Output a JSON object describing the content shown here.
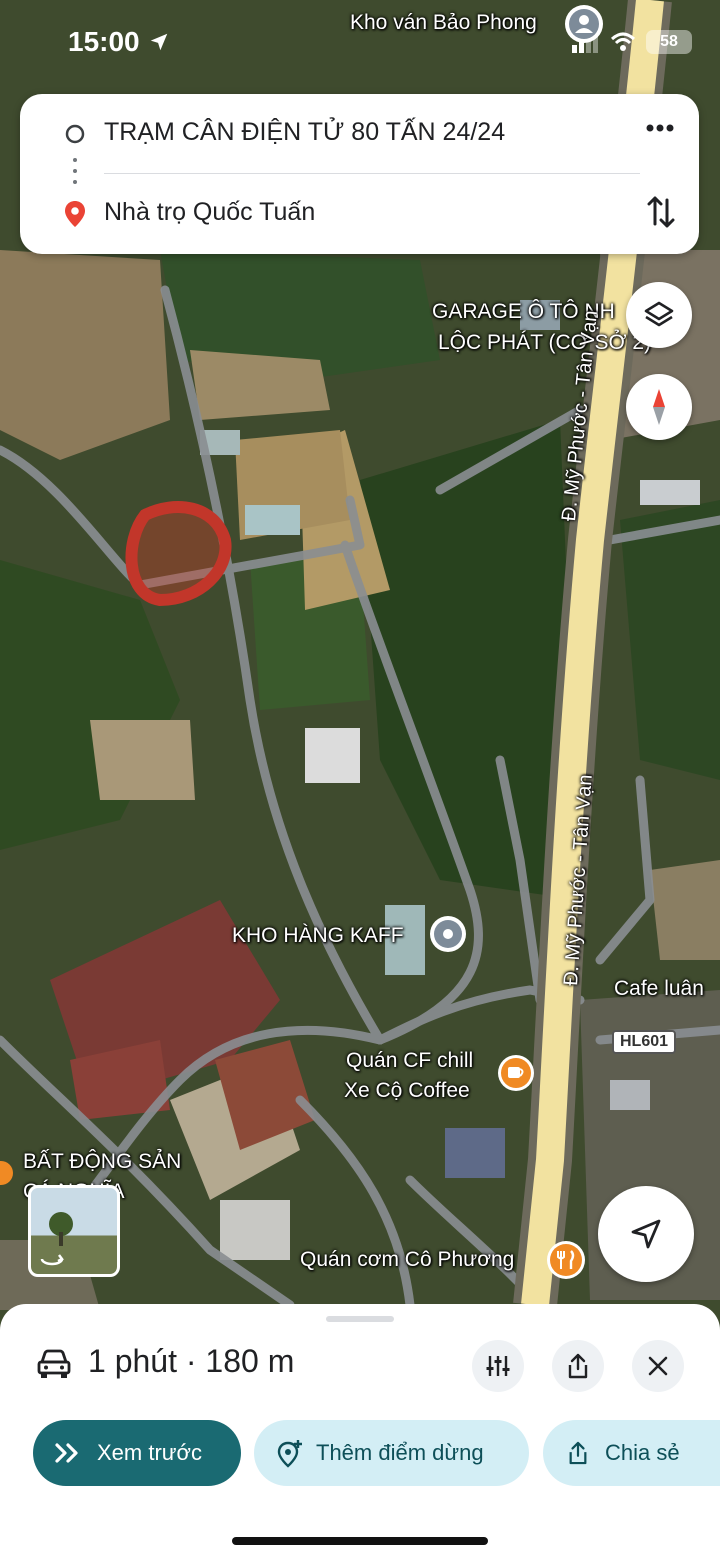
{
  "status_bar": {
    "time": "15:00",
    "battery": "58"
  },
  "route": {
    "origin": "TRẠM CÂN ĐIỆN TỬ 80 TẤN 24/24",
    "destination": "Nhà trọ Quốc Tuấn"
  },
  "map_labels": {
    "kho_van": "Kho ván Bảo Phong",
    "garage_line1": "GARAGE Ô TÔ NH",
    "garage_line2": "LỘC PHÁT (CƠ SỞ 2)",
    "road_upper": "Đ. Mỹ Phước - Tân Vạn",
    "road_lower": "Đ. Mỹ Phước - Tân Vạn",
    "kho_hang": "KHO HÀNG KAFF",
    "cafe_luan": "Cafe luân",
    "hl601": "HL601",
    "quan_cf_line1": "Quán CF chill",
    "quan_cf_line2": "Xe Cộ Coffee",
    "bds_line1": "BẤT ĐỘNG SẢN",
    "bds_line2": "CÁ NGHĨA",
    "quan_com": "Quán cơm Cô Phương"
  },
  "bottom_sheet": {
    "eta": "1 phút",
    "separator": "·",
    "distance": "180 m",
    "preview_label": "Xem trước",
    "add_stop_label": "Thêm điểm dừng",
    "share_label": "Chia sẻ"
  },
  "colors": {
    "accent_teal": "#1a6a72",
    "pill_light": "#d3eef5",
    "pin_red": "#ea4335",
    "poi_orange": "#f08a24",
    "poi_gray": "#7d8b99",
    "road_yellow": "#f2e2a0"
  },
  "icons": [
    "location-arrow-icon",
    "signal-icon",
    "wifi-icon",
    "origin-circle-icon",
    "route-dots-icon",
    "destination-pin-icon",
    "more-icon",
    "swap-icon",
    "layers-icon",
    "compass-icon",
    "recenter-arrow-icon",
    "car-icon",
    "filter-icon",
    "share-icon",
    "close-icon",
    "double-chevron-icon",
    "add-stop-icon",
    "street-view-icon",
    "cup-icon",
    "fork-knife-icon"
  ]
}
